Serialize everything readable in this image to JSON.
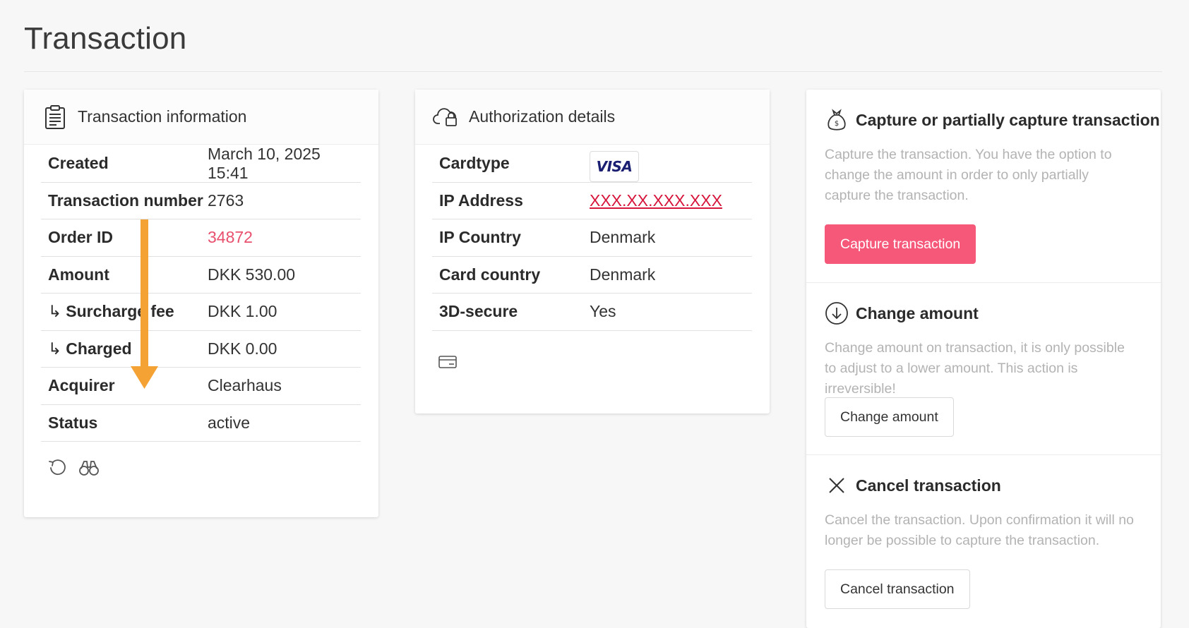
{
  "page": {
    "title": "Transaction"
  },
  "transaction_info": {
    "title": "Transaction information",
    "rows": [
      {
        "key": "Created",
        "value": "March 10, 2025 15:41"
      },
      {
        "key": "Transaction number",
        "value": "2763"
      },
      {
        "key": "Order ID",
        "value": "34872"
      },
      {
        "key": "Amount",
        "value": "DKK 530.00"
      },
      {
        "key": "Surcharge fee",
        "value": "DKK 1.00"
      },
      {
        "key": "Charged",
        "value": "DKK 0.00"
      },
      {
        "key": "Acquirer",
        "value": "Clearhaus"
      },
      {
        "key": "Status",
        "value": "active"
      }
    ],
    "sub_prefix": "↳"
  },
  "authorization": {
    "title": "Authorization details",
    "rows": [
      {
        "key": "Cardtype",
        "value": "VISA"
      },
      {
        "key": "IP Address",
        "value": "XXX.XX.XXX.XXX"
      },
      {
        "key": "IP Country",
        "value": "Denmark"
      },
      {
        "key": "Card country",
        "value": "Denmark"
      },
      {
        "key": "3D-secure",
        "value": "Yes"
      }
    ]
  },
  "actions": {
    "capture": {
      "title": "Capture or partially capture transaction",
      "description": "Capture the transaction. You have the option to change the amount in order to only partially capture the transaction.",
      "button": "Capture transaction"
    },
    "change_amount": {
      "title": "Change amount",
      "description": "Change amount on transaction, it is only possible to adjust to a lower amount. This action is irreversible!",
      "button": "Change amount"
    },
    "cancel": {
      "title": "Cancel transaction",
      "description": "Cancel the transaction. Upon confirmation it will no longer be possible to capture the transaction.",
      "button": "Cancel transaction"
    }
  },
  "colors": {
    "accent": "#f6587a",
    "link": "#e8506e",
    "ip_link": "#d6163c",
    "annotation_arrow": "#f5a235",
    "visa_blue": "#1a1f71"
  },
  "icons": {
    "transaction_info": "clipboard-icon",
    "authorization": "cloud-lock-icon",
    "capture": "money-bag-icon",
    "change_amount": "arrow-down-circle-icon",
    "cancel": "close-icon",
    "refresh": "refresh-icon",
    "inspect": "binoculars-icon",
    "card": "credit-card-icon"
  }
}
